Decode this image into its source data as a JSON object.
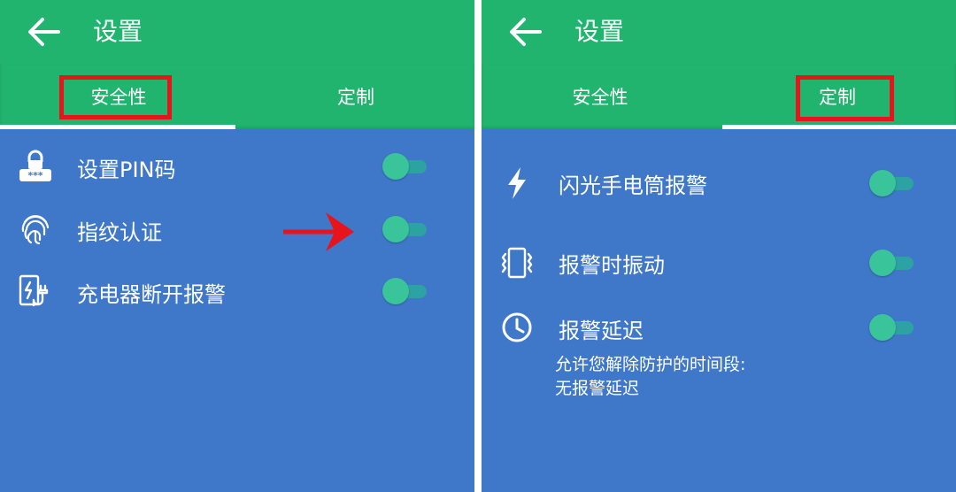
{
  "colors": {
    "appbar": "#21b46e",
    "content": "#3f78c9",
    "toggle_thumb": "#3ac49a",
    "toggle_track": "#2ca3a2",
    "highlight": "#e8141c"
  },
  "left_panel": {
    "title": "设置",
    "back_icon": "arrow-back-icon",
    "tabs": [
      {
        "label": "安全性",
        "selected": true
      },
      {
        "label": "定制",
        "selected": false
      }
    ],
    "items": [
      {
        "label": "设置PIN码",
        "icon": "pin-lock-icon",
        "toggle_on": true
      },
      {
        "label": "指纹认证",
        "icon": "fingerprint-icon",
        "toggle_on": true
      },
      {
        "label": "充电器断开报警",
        "icon": "charger-icon",
        "toggle_on": true
      }
    ],
    "annotation_arrow": "red-arrow-icon"
  },
  "right_panel": {
    "title": "设置",
    "back_icon": "arrow-back-icon",
    "tabs": [
      {
        "label": "安全性",
        "selected": false
      },
      {
        "label": "定制",
        "selected": true
      }
    ],
    "items": [
      {
        "label": "闪光手电筒报警",
        "icon": "flash-icon",
        "toggle_on": true
      },
      {
        "label": "报警时振动",
        "icon": "vibrate-icon",
        "toggle_on": true
      },
      {
        "label": "报警延迟",
        "icon": "clock-icon",
        "toggle_on": true,
        "subtitle_1": "允许您解除防护的时间段:",
        "subtitle_2": "无报警延迟"
      }
    ]
  }
}
